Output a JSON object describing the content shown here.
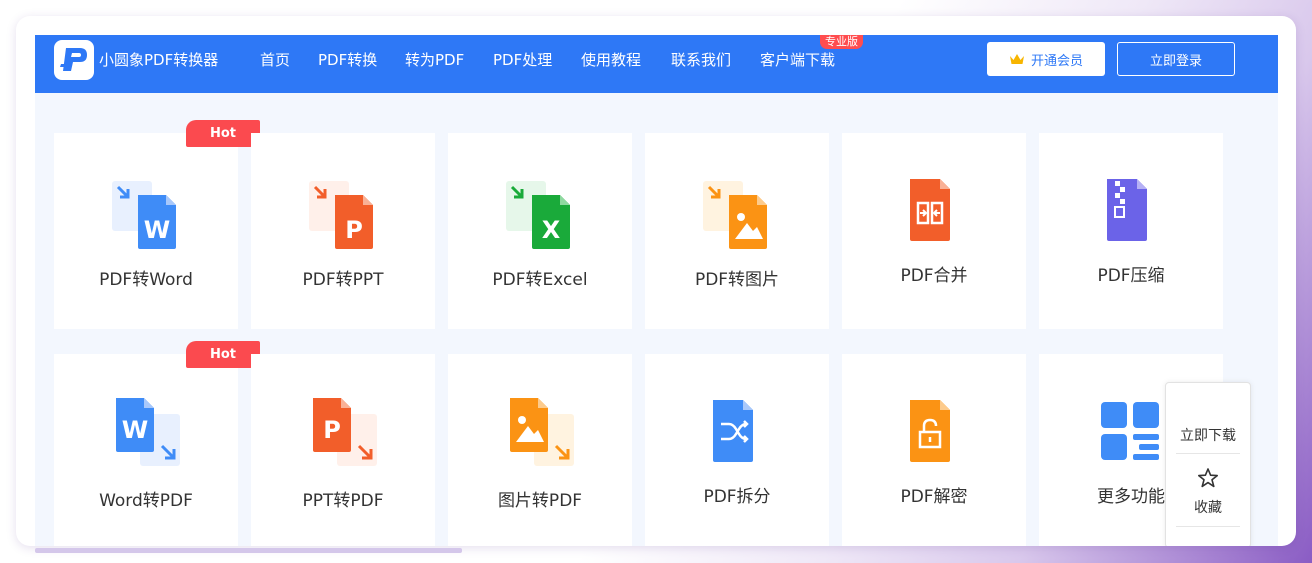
{
  "header": {
    "brand": "小圆象PDF转换器",
    "nav": [
      "首页",
      "PDF转换",
      "转为PDF",
      "PDF处理",
      "使用教程",
      "联系我们",
      "客户端下载"
    ],
    "pro_badge": "专业版",
    "vip_button": "开通会员",
    "login_button": "立即登录",
    "colors": {
      "bar": "#2e78f6",
      "badge": "#ff4d4f",
      "crown": "#f7b500"
    }
  },
  "tools": {
    "hot_label": "Hot",
    "row1": [
      {
        "label": "PDF转Word",
        "icon": "pdf-to-word-icon",
        "hot": true
      },
      {
        "label": "PDF转PPT",
        "icon": "pdf-to-ppt-icon",
        "hot": false
      },
      {
        "label": "PDF转Excel",
        "icon": "pdf-to-excel-icon",
        "hot": false
      },
      {
        "label": "PDF转图片",
        "icon": "pdf-to-image-icon",
        "hot": false
      },
      {
        "label": "PDF合并",
        "icon": "pdf-merge-icon",
        "hot": false
      },
      {
        "label": "PDF压缩",
        "icon": "pdf-compress-icon",
        "hot": false
      }
    ],
    "row2": [
      {
        "label": "Word转PDF",
        "icon": "word-to-pdf-icon",
        "hot": true
      },
      {
        "label": "PPT转PDF",
        "icon": "ppt-to-pdf-icon",
        "hot": false
      },
      {
        "label": "图片转PDF",
        "icon": "image-to-pdf-icon",
        "hot": false
      },
      {
        "label": "PDF拆分",
        "icon": "pdf-split-icon",
        "hot": false
      },
      {
        "label": "PDF解密",
        "icon": "pdf-decrypt-icon",
        "hot": false
      },
      {
        "label": "更多功能",
        "icon": "more-functions-icon",
        "hot": false
      }
    ]
  },
  "float_panel": {
    "download": "立即下载",
    "favorite": "收藏",
    "star_icon": "star-icon"
  }
}
